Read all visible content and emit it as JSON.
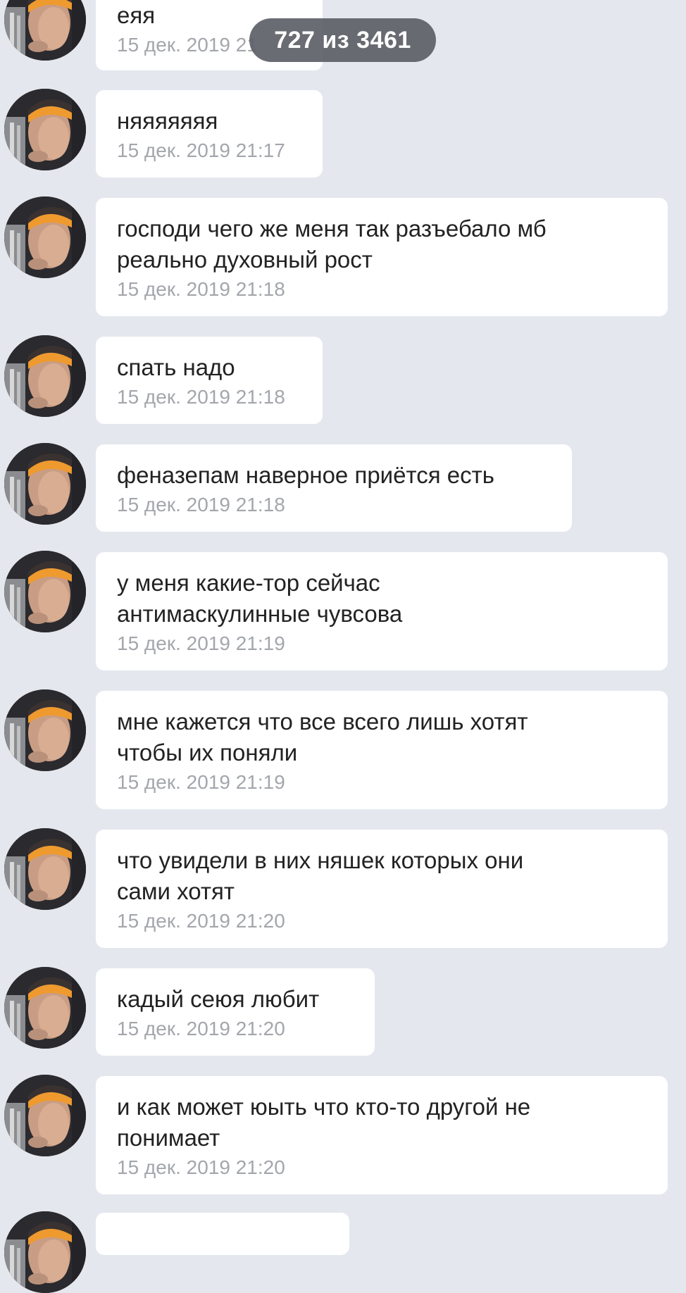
{
  "counter": {
    "label": "727 из 3461"
  },
  "messages": [
    {
      "text": "еяя",
      "time": "15 дек. 2019 21"
    },
    {
      "text": "няяяяяяя",
      "time": "15 дек. 2019 21:17"
    },
    {
      "text": "господи чего же меня так разъебало мб\nреально духовный рост",
      "time": "15 дек. 2019 21:18"
    },
    {
      "text": "спать надо",
      "time": "15 дек. 2019 21:18"
    },
    {
      "text": "феназепам наверное приётся есть",
      "time": "15 дек. 2019 21:18"
    },
    {
      "text": "у меня какие-тор сейчас\nантимаскулинные чувсова",
      "time": "15 дек. 2019 21:19"
    },
    {
      "text": "мне кажется что все всего лишь хотят\nчтобы их поняли",
      "time": "15 дек. 2019 21:19"
    },
    {
      "text": "что увидели в них няшек которых они\nсами хотят",
      "time": "15 дек. 2019 21:20"
    },
    {
      "text": "кадый сеюя любит",
      "time": "15 дек. 2019 21:20"
    },
    {
      "text": "и как может юыть что кто-то другой не\nпонимает",
      "time": "15 дек. 2019 21:20"
    }
  ],
  "colors": {
    "background": "#e4e8ee",
    "bubble": "#ffffff",
    "text": "#222222",
    "timestamp": "#a3a6ab",
    "counter_bg": "#5c6066"
  }
}
